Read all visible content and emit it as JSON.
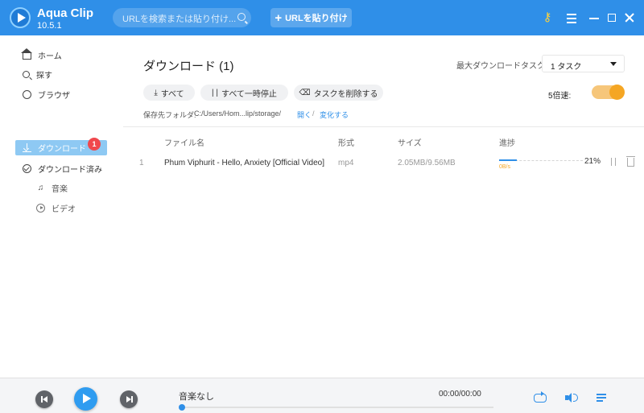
{
  "app": {
    "name": "Aqua Clip",
    "version": "10.5.1"
  },
  "header": {
    "search_placeholder": "URLを検索または貼り付け...",
    "paste_button": "URLを貼り付け"
  },
  "sidebar": {
    "items": [
      {
        "label": "ホーム",
        "icon": "home-icon"
      },
      {
        "label": "探す",
        "icon": "search-icon"
      },
      {
        "label": "ブラウザ",
        "icon": "globe-icon"
      }
    ],
    "download": {
      "label": "ダウンロード",
      "badge": "1"
    },
    "downloaded": {
      "label": "ダウンロード済み"
    },
    "sub_items": [
      {
        "label": "音楽",
        "icon": "music-note-icon"
      },
      {
        "label": "ビデオ",
        "icon": "video-icon"
      }
    ]
  },
  "main": {
    "title": "ダウンロード (1)",
    "max_tasks_label": "最大ダウンロードタスク:",
    "max_tasks_value": "1 タスク",
    "buttons": {
      "all": "すべて",
      "pause_all": "すべて一時停止",
      "delete_tasks": "タスクを削除する"
    },
    "speed_label": "5倍速:",
    "speed_enabled": true,
    "folder_label": "保存先フォルダ:",
    "folder_path": "C:/Users/Hom...lip/storage/",
    "open_link": "開く",
    "change_link": "変化する",
    "separator": "/",
    "columns": {
      "name": "ファイル名",
      "format": "形式",
      "size": "サイズ",
      "progress": "進捗"
    },
    "rows": [
      {
        "index": "1",
        "name": "Phum Viphurit - Hello, Anxiety [Official Video]",
        "format": "mp4",
        "size": "2.05MB/9.56MB",
        "progress_percent": 21,
        "progress_label": "21%",
        "rate": "0B/s"
      }
    ]
  },
  "player": {
    "track_name": "音楽なし",
    "time": "00:00/00:00",
    "seek_fraction": 0
  },
  "colors": {
    "accent": "#2f8fe8",
    "badge": "#f0484d",
    "toggle": "#f5a623"
  }
}
